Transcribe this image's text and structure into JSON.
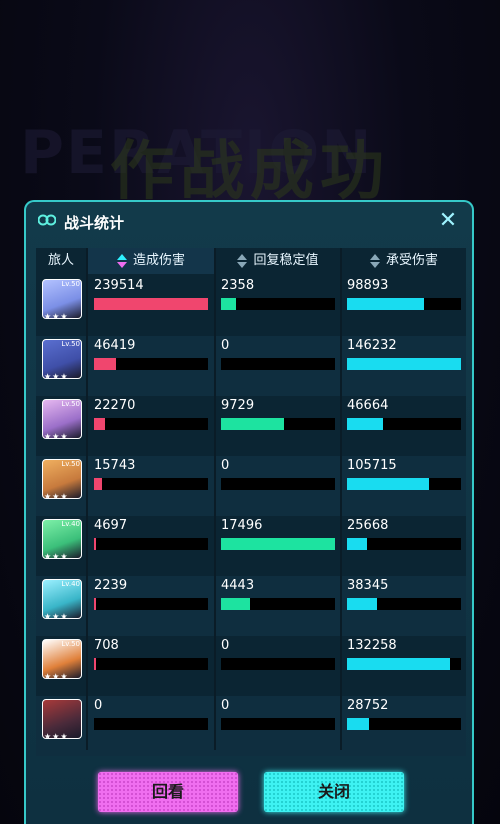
{
  "background_title": "作战成功",
  "background_ghost_text": "PERATION",
  "panel": {
    "title": "战斗统计",
    "close_label": "✕"
  },
  "table": {
    "headers": {
      "traveler": "旅人",
      "damage_dealt": "造成伤害",
      "heal_stability": "回复稳定值",
      "damage_taken": "承受伤害"
    },
    "sorted_column": "damage_dealt",
    "rows": [
      {
        "level": "Lv.50",
        "damage_dealt": "239514",
        "heal_stability": "2358",
        "damage_taken": "98893",
        "dd": 1.0,
        "hs": 0.135,
        "dt": 0.676,
        "avatar_color": "#7b8fe6",
        "hair": "#b3c2ff"
      },
      {
        "level": "Lv.50",
        "damage_dealt": "46419",
        "heal_stability": "0",
        "damage_taken": "146232",
        "dd": 0.194,
        "hs": 0.0,
        "dt": 1.0,
        "avatar_color": "#3f4fa8",
        "hair": "#5a6fd0"
      },
      {
        "level": "Lv.50",
        "damage_dealt": "22270",
        "heal_stability": "9729",
        "damage_taken": "46664",
        "dd": 0.093,
        "hs": 0.556,
        "dt": 0.319,
        "avatar_color": "#9b6fc9",
        "hair": "#e6b8f0"
      },
      {
        "level": "Lv.50",
        "damage_dealt": "15743",
        "heal_stability": "0",
        "damage_taken": "105715",
        "dd": 0.066,
        "hs": 0.0,
        "dt": 0.723,
        "avatar_color": "#c77a3d",
        "hair": "#f0b060"
      },
      {
        "level": "Lv.40",
        "damage_dealt": "4697",
        "heal_stability": "17496",
        "damage_taken": "25668",
        "dd": 0.02,
        "hs": 1.0,
        "dt": 0.176,
        "avatar_color": "#3bbf7a",
        "hair": "#7ef0a8"
      },
      {
        "level": "Lv.40",
        "damage_dealt": "2239",
        "heal_stability": "4443",
        "damage_taken": "38345",
        "dd": 0.009,
        "hs": 0.254,
        "dt": 0.262,
        "avatar_color": "#39b5c8",
        "hair": "#9cf0ff"
      },
      {
        "level": "Lv.50",
        "damage_dealt": "708",
        "heal_stability": "0",
        "damage_taken": "132258",
        "dd": 0.003,
        "hs": 0.0,
        "dt": 0.904,
        "avatar_color": "#e0803a",
        "hair": "#ffffff"
      },
      {
        "level": "",
        "damage_dealt": "0",
        "heal_stability": "0",
        "damage_taken": "28752",
        "dd": 0.0,
        "hs": 0.0,
        "dt": 0.197,
        "avatar_color": "#4a2a3a",
        "hair": "#a83a3a"
      }
    ]
  },
  "buttons": {
    "replay": "回看",
    "close": "关闭"
  },
  "colors": {
    "damage_dealt": "#f0466e",
    "heal_stability": "#1de3a0",
    "damage_taken": "#19dcf0",
    "panel_border": "#36c9c9"
  }
}
